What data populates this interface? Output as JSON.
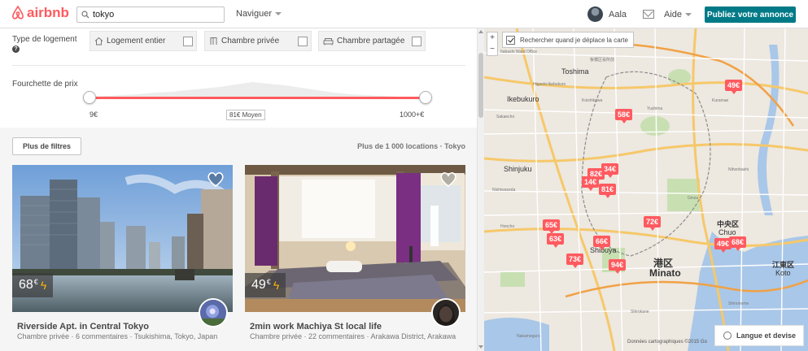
{
  "header": {
    "logo_text": "airbnb",
    "search_value": "tokyo",
    "browse_label": "Naviguer",
    "user_name": "Aala",
    "help_label": "Aide",
    "host_button": "Publiez votre annonce"
  },
  "filters": {
    "room_type_label": "Type de logement",
    "room_types": [
      {
        "label": "Logement entier",
        "icon": "home-icon",
        "checked": false
      },
      {
        "label": "Chambre privée",
        "icon": "door-icon",
        "checked": false
      },
      {
        "label": "Chambre partagée",
        "icon": "couch-icon",
        "checked": false
      }
    ],
    "price_label": "Fourchette de prix",
    "price_min": "9€",
    "price_max": "1000+€",
    "price_average": "81€ Moyen"
  },
  "results": {
    "more_filters": "Plus de filtres",
    "count_text": "Plus de 1 000 locations · Tokyo",
    "listings": [
      {
        "price": "68",
        "currency": "€",
        "instant_book": true,
        "title": "Riverside Apt. in Central Tokyo",
        "subtitle": "Chambre privée · 6 commentaires · Tsukishima, Tokyo, Japan"
      },
      {
        "price": "49",
        "currency": "€",
        "instant_book": true,
        "title": "2min work Machiya St local life",
        "subtitle": "Chambre privée · 22 commentaires · Arakawa District, Arakawa"
      }
    ]
  },
  "map": {
    "search_on_move_label": "Rechercher quand je déplace la carte",
    "search_on_move_checked": true,
    "zoom_in": "+",
    "zoom_out": "−",
    "pins": [
      "49€",
      "58€",
      "34€",
      "82€",
      "14€",
      "81€",
      "72€",
      "65€",
      "63€",
      "66€",
      "73€",
      "94€",
      "49€",
      "68€"
    ],
    "labels": {
      "minato_jp": "港区",
      "minato": "Minato",
      "chuo_jp": "中央区",
      "chuo": "Chuo",
      "koto_jp": "江東区",
      "koto": "Koto",
      "shibuya": "Shibuya",
      "shinjuku": "Shinjuku",
      "toshima": "Toshima",
      "ikebukuro": "Ikebukuro"
    },
    "attribution": "Données cartographiques ©2015 Go",
    "language_button": "Langue et devise"
  },
  "colors": {
    "brand": "#ff5a5f",
    "host_button": "#007a87",
    "text": "#484848"
  }
}
